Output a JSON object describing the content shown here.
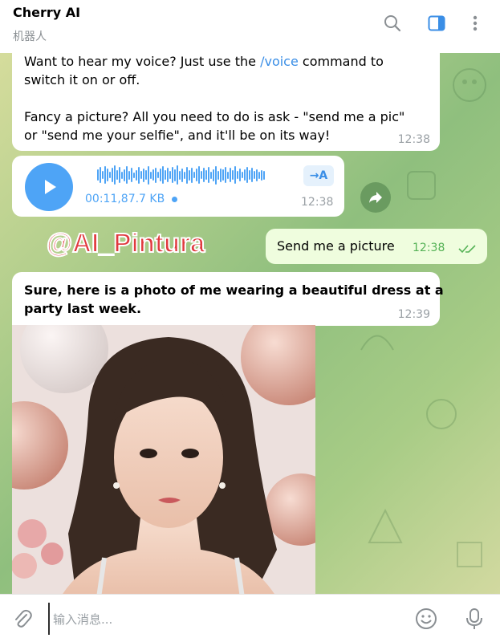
{
  "header": {
    "title": "Cherry AI",
    "subtitle": "机器人",
    "icons": [
      "search-icon",
      "sidebar-panel-icon",
      "more-vertical-icon"
    ]
  },
  "messages": {
    "m1": {
      "line1a": "Want to hear my voice? Just use the ",
      "command": "/voice",
      "line1b": " command to",
      "line2": "switch it on or off.",
      "line3": "Fancy a picture? All you need to do is ask - \"send me a pic\"",
      "line4": "or \"send me your selfie\", and it'll be on its way!",
      "time": "12:38"
    },
    "voice": {
      "meta": "00:11,87.7 KB",
      "transcribe_label": "→A",
      "time": "12:38"
    },
    "out": {
      "text": "Send me a picture",
      "time": "12:38"
    },
    "reply": {
      "line1": "Sure, here is a photo of me wearing a beautiful dress at a",
      "line2": "party last week.",
      "time": "12:39"
    }
  },
  "watermark": "@AI_Pintura",
  "composer": {
    "placeholder": "输入消息..."
  },
  "colors": {
    "accent": "#4ea4f6",
    "outgoing_bubble": "#effdde",
    "outgoing_time": "#55b256",
    "chat_bg": "#a8cc86"
  }
}
